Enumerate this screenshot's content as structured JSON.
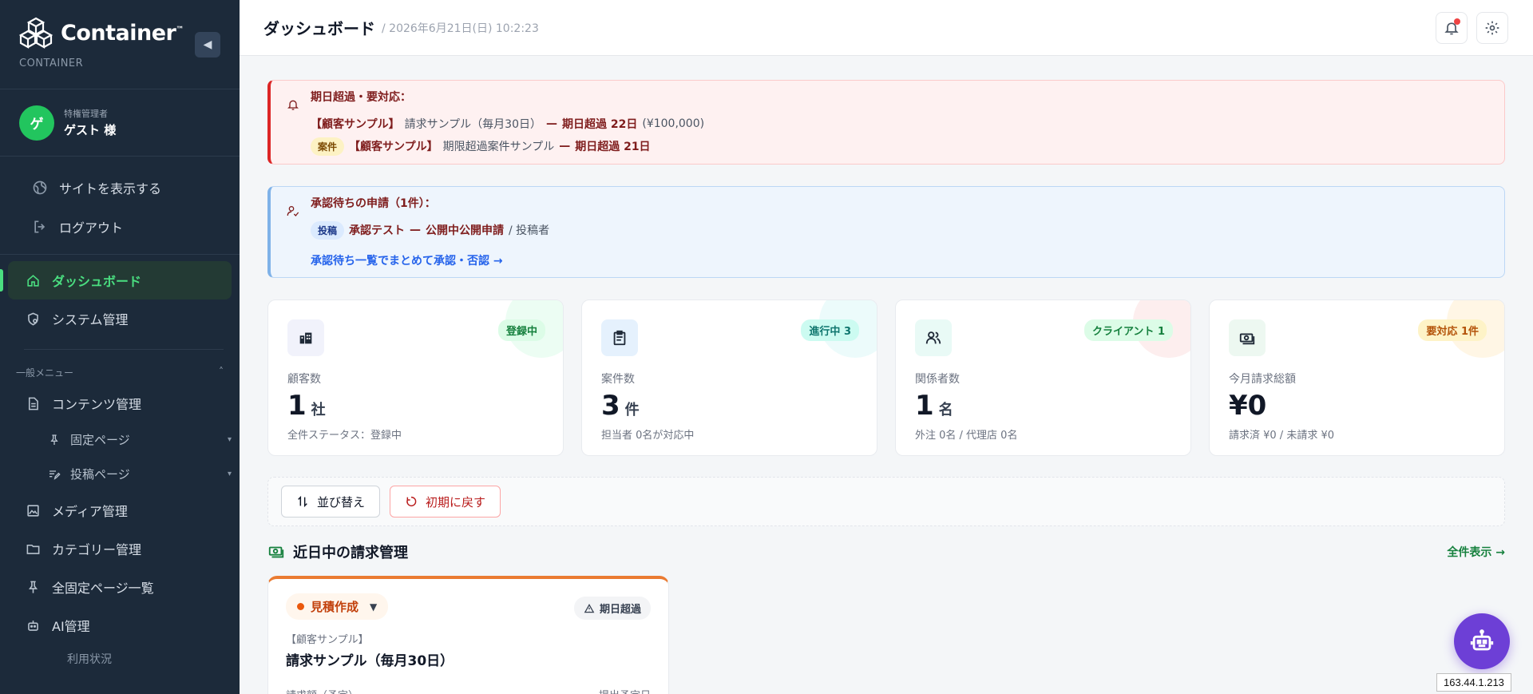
{
  "brand": {
    "name": "Container",
    "tm": "™",
    "sub": "CONTAINER"
  },
  "user": {
    "initial": "ゲ",
    "role": "特権管理者",
    "name": "ゲスト 様"
  },
  "side_links": [
    {
      "label": "サイトを表示する",
      "icon": "globe-icon"
    },
    {
      "label": "ログアウト",
      "icon": "logout-icon"
    }
  ],
  "nav": {
    "dashboard": "ダッシュボード",
    "system": "システム管理",
    "group_label": "一般メニュー",
    "content": "コンテンツ管理",
    "fixed_page": "固定ページ",
    "post_page": "投稿ページ",
    "media": "メディア管理",
    "category": "カテゴリー管理",
    "all_fixed": "全固定ページ一覧",
    "ai": "AI管理",
    "usage": "利用状況"
  },
  "header": {
    "title": "ダッシュボード",
    "date": "/ 2026年6月21日(日) 10:2:23"
  },
  "alert_overdue": {
    "title": "期日超過・要対応：",
    "line1_client": "【顧客サンプル】",
    "line1_text": "請求サンプル（毎月30日）",
    "line1_dash": "—",
    "line1_overdue": "期日超過 22日",
    "line1_amount": "(¥100,000)",
    "line2_pill": "案件",
    "line2_client": "【顧客サンプル】",
    "line2_text": "期限超過案件サンプル",
    "line2_dash": "—",
    "line2_overdue": "期日超過 21日"
  },
  "alert_approval": {
    "title": "承認待ちの申請（1件）：",
    "pill": "投稿",
    "item": "承認テスト",
    "dash": "—",
    "type": "公開中公開申請",
    "by": "/ 投稿者",
    "link": "承認待ち一覧でまとめて承認・否認 →"
  },
  "stats": [
    {
      "badge": "登録中",
      "label": "顧客数",
      "value": "1",
      "unit": "社",
      "sub": "全件ステータス：登録中",
      "color": "#16a34a"
    },
    {
      "badge": "進行中 3",
      "label": "案件数",
      "value": "3",
      "unit": "件",
      "sub": "担当者 0名が対応中",
      "color": "#0f766e"
    },
    {
      "badge": "クライアント 1",
      "label": "関係者数",
      "value": "1",
      "unit": "名",
      "sub": "外注 0名 / 代理店 0名",
      "color": "#15803d"
    },
    {
      "badge": "要対応 1件",
      "label": "今月請求総額",
      "value": "¥0",
      "unit": "",
      "sub": "請求済 ¥0 / 未請求 ¥0",
      "color": "#b45309"
    }
  ],
  "toolbar": {
    "sort": "並び替え",
    "reset": "初期に戻す"
  },
  "billing": {
    "section_title": "近日中の請求管理",
    "view_all": "全件表示 →",
    "status": "見積作成",
    "overdue": "期日超過",
    "client": "【顧客サンプル】",
    "name": "請求サンプル（毎月30日）",
    "amount_label": "請求額（予定）",
    "due_label": "提出予定日"
  },
  "ip": "163.44.1.213"
}
